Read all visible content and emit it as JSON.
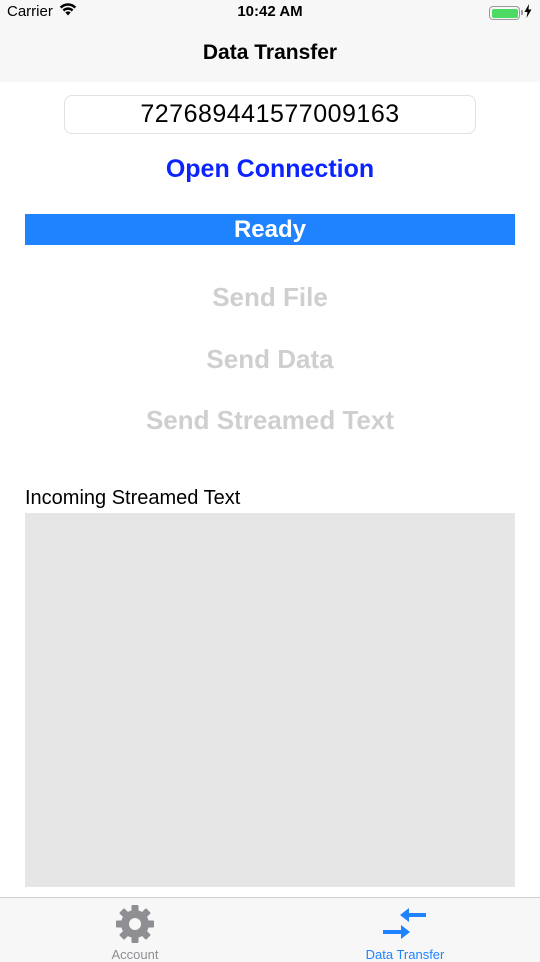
{
  "status_bar": {
    "carrier": "Carrier",
    "time": "10:42 AM"
  },
  "nav": {
    "title": "Data Transfer"
  },
  "connection_code": "727689441577009163",
  "actions": {
    "open_connection": "Open Connection",
    "status": "Ready",
    "send_file": "Send File",
    "send_data": "Send Data",
    "send_streamed_text": "Send Streamed Text"
  },
  "incoming": {
    "label": "Incoming Streamed Text",
    "text": ""
  },
  "tabs": [
    {
      "label": "Account",
      "icon": "gear-icon",
      "selected": false
    },
    {
      "label": "Data Transfer",
      "icon": "transfer-arrows-icon",
      "selected": true
    }
  ],
  "colors": {
    "accent": "#1f83ff",
    "link": "#0b24ff",
    "disabled": "#cfcfcf",
    "battery": "#4cd964"
  }
}
